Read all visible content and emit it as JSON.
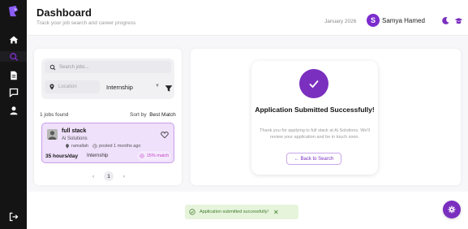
{
  "header": {
    "title": "Dashboard",
    "subtitle": "Track your job search and career progress",
    "date": "January 2026",
    "avatar_initial": "S",
    "user_name": "Samya Hamed"
  },
  "search": {
    "placeholder": "Search jobs...",
    "location_placeholder": "Location",
    "job_type": "Internship"
  },
  "results": {
    "count_text": "1 jobs found",
    "sort_label": "Sort by",
    "sort_value": "Best Match"
  },
  "job": {
    "title": "full stack",
    "company": "Ai Solutions",
    "location": "ramallah",
    "posted": "posted 1 months ago",
    "hours": "35 hours/day",
    "type": "Internship",
    "match": "15% match"
  },
  "pagination": {
    "prev": "‹",
    "page": "1",
    "next": "›"
  },
  "success": {
    "title": "Application Submitted Successfully!",
    "message": "Thank you for applying to full stack at Ai Solutions. We'll review your application and be in touch soon.",
    "back_label": "← Back to Search"
  },
  "toast": {
    "message": "Application submitted successfully!",
    "close": "✕"
  },
  "sidebar": {
    "icons": [
      "logo-icon",
      "home-icon",
      "search-icon",
      "document-icon",
      "messages-icon",
      "profile-icon",
      "logout-icon"
    ]
  },
  "colors": {
    "accent": "#7a2fbf",
    "sidebar_bg": "#141414",
    "card_bg": "#efe0fb",
    "match_text": "#c23fc6",
    "toast_bg": "#e6f4dc"
  }
}
